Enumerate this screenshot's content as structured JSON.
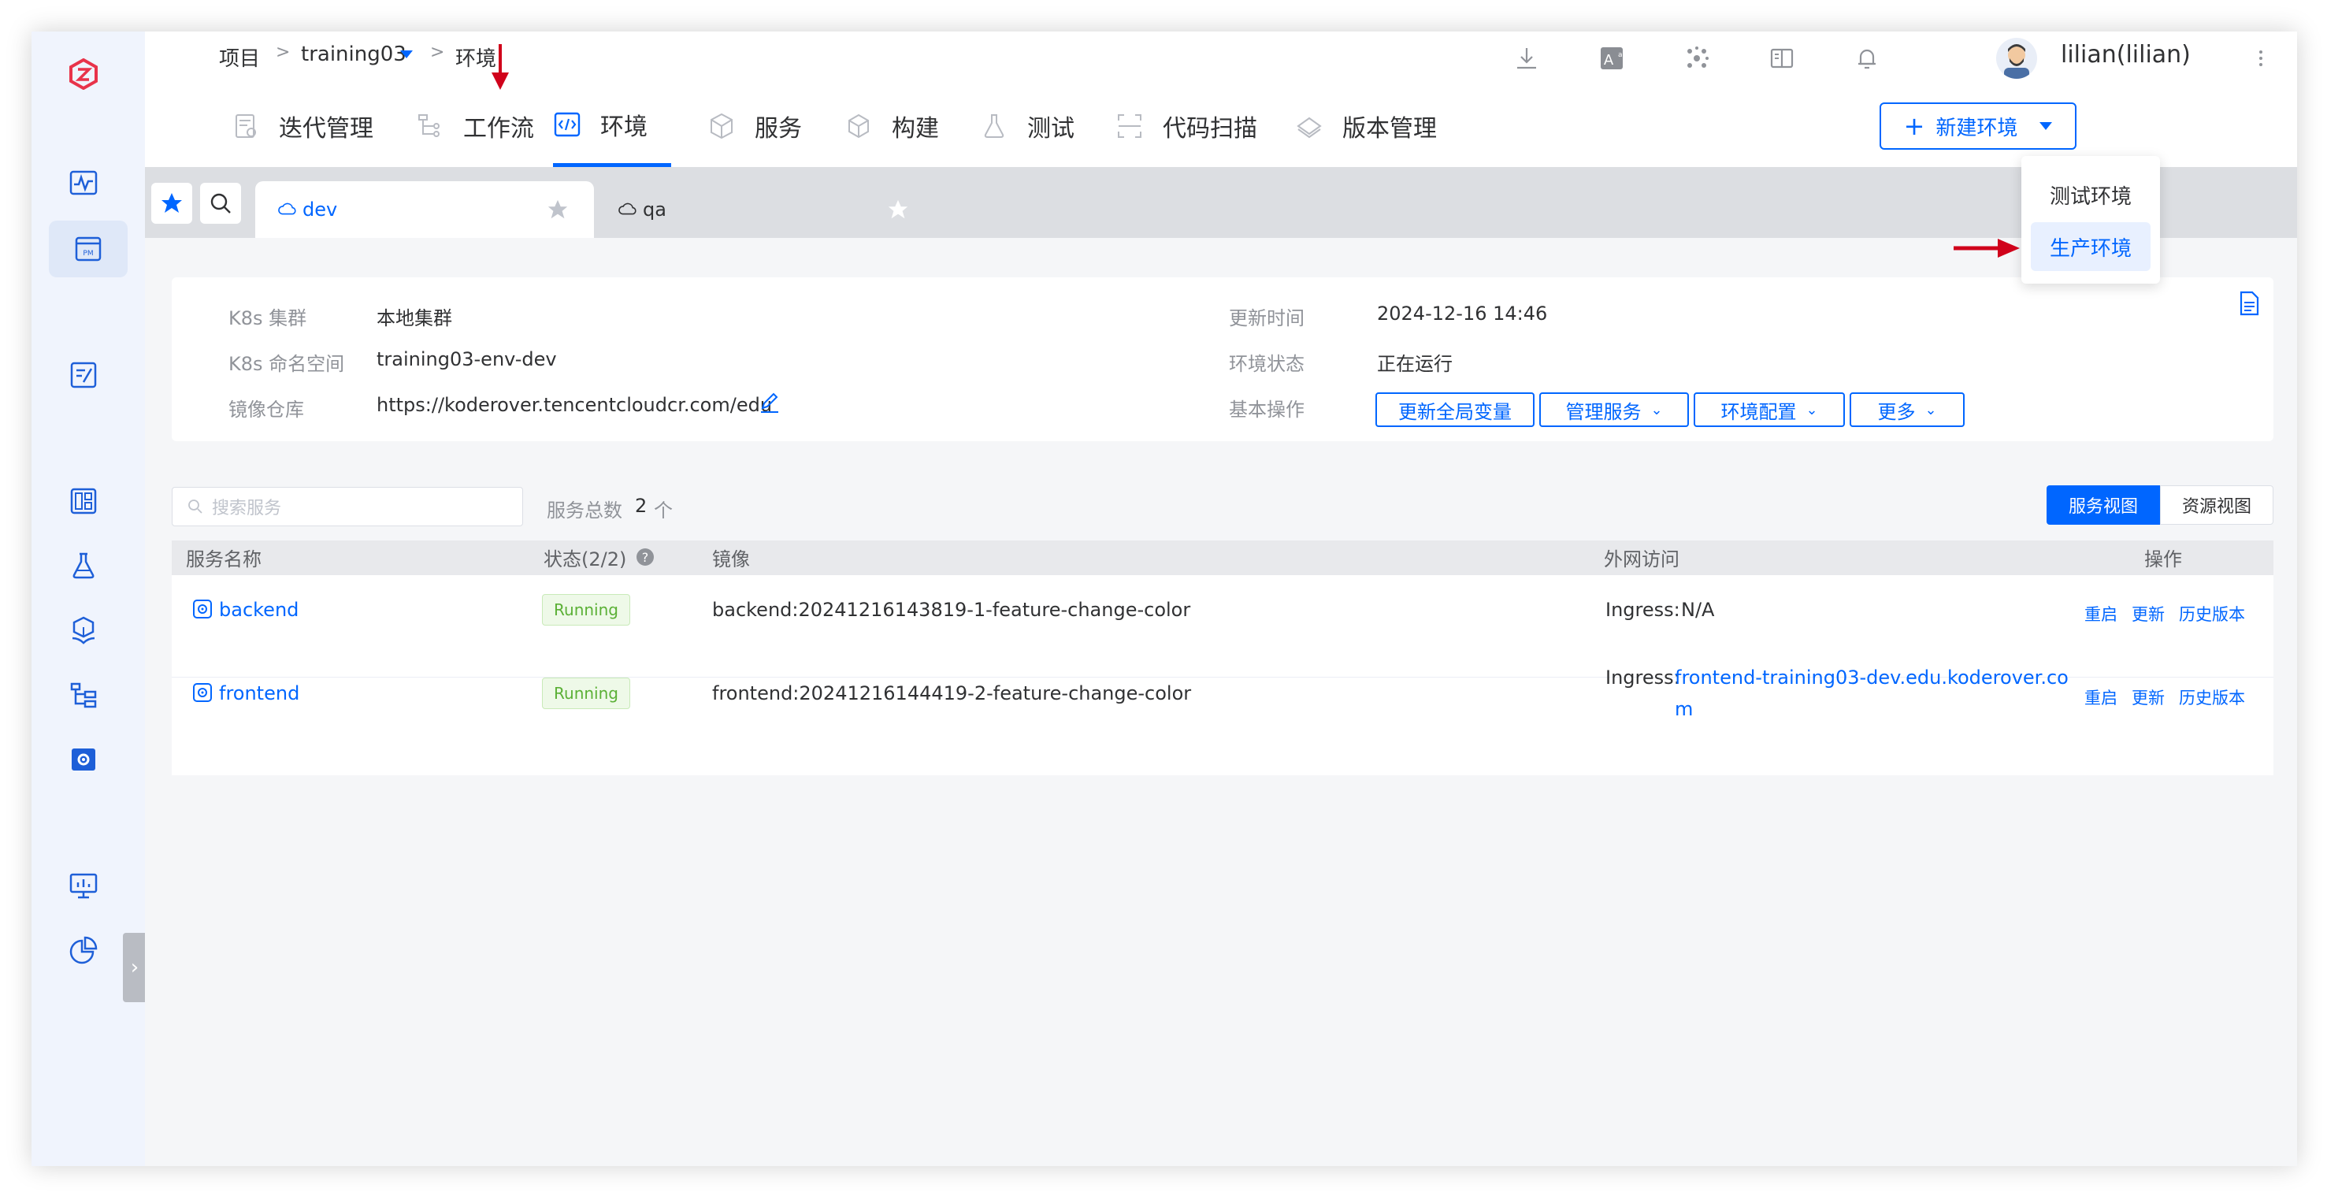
{
  "breadcrumb": {
    "root": "项目",
    "sep1": ">",
    "project": "training03",
    "sep2": ">",
    "current": "环境"
  },
  "user": {
    "name": "lilian(lilian)"
  },
  "top_icons": [
    "download-icon",
    "translate-icon",
    "cluster-icon",
    "book-icon",
    "bell-icon",
    "more-vertical-icon"
  ],
  "nav": {
    "items": [
      {
        "label": "迭代管理",
        "icon": "iteration-icon"
      },
      {
        "label": "工作流",
        "icon": "workflow-icon"
      },
      {
        "label": "环境",
        "icon": "environment-icon",
        "active": true
      },
      {
        "label": "服务",
        "icon": "service-icon"
      },
      {
        "label": "构建",
        "icon": "build-icon"
      },
      {
        "label": "测试",
        "icon": "test-icon"
      },
      {
        "label": "代码扫描",
        "icon": "scan-icon"
      },
      {
        "label": "版本管理",
        "icon": "version-icon"
      }
    ],
    "new_env_label": "新建环境",
    "new_env_plus": "+"
  },
  "dropdown": {
    "items": [
      "测试环境",
      "生产环境"
    ]
  },
  "env_tabs": [
    {
      "label": "dev",
      "active": true
    },
    {
      "label": "qa",
      "active": false
    }
  ],
  "env_info": {
    "k8s_cluster_label": "K8s 集群",
    "k8s_cluster_value": "本地集群",
    "k8s_ns_label": "K8s 命名空间",
    "k8s_ns_value": "training03-env-dev",
    "registry_label": "镜像仓库",
    "registry_value": "https://koderover.tencentcloudcr.com/edu",
    "update_time_label": "更新时间",
    "update_time_value": "2024-12-16 14:46",
    "status_label": "环境状态",
    "status_value": "正在运行",
    "ops_label": "基本操作",
    "ops": [
      "更新全局变量",
      "管理服务",
      "环境配置",
      "更多"
    ]
  },
  "services": {
    "search_placeholder": "搜索服务",
    "total_label": "服务总数",
    "total_count": "2",
    "total_unit": "个",
    "view_service": "服务视图",
    "view_resource": "资源视图",
    "columns": [
      "服务名称",
      "状态(2/2)",
      "镜像",
      "外网访问",
      "操作"
    ],
    "rows": [
      {
        "name": "backend",
        "status": "Running",
        "image": "backend:20241216143819-1-feature-change-color",
        "ingress_label": "Ingress:",
        "ingress_value": "N/A",
        "ingress_value2": "",
        "actions": [
          "重启",
          "更新",
          "历史版本"
        ]
      },
      {
        "name": "frontend",
        "status": "Running",
        "image": "frontend:20241216144419-2-feature-change-color",
        "ingress_label": "Ingress:",
        "ingress_value": "frontend-training03-dev.edu.koderover.co",
        "ingress_value2": "m",
        "actions": [
          "重启",
          "更新",
          "历史版本"
        ]
      }
    ]
  },
  "colors": {
    "primary": "#0066ff",
    "running_text": "#5bb036",
    "arrow_red": "#d0021b",
    "sidebar_bg": "#f0f4fd"
  }
}
